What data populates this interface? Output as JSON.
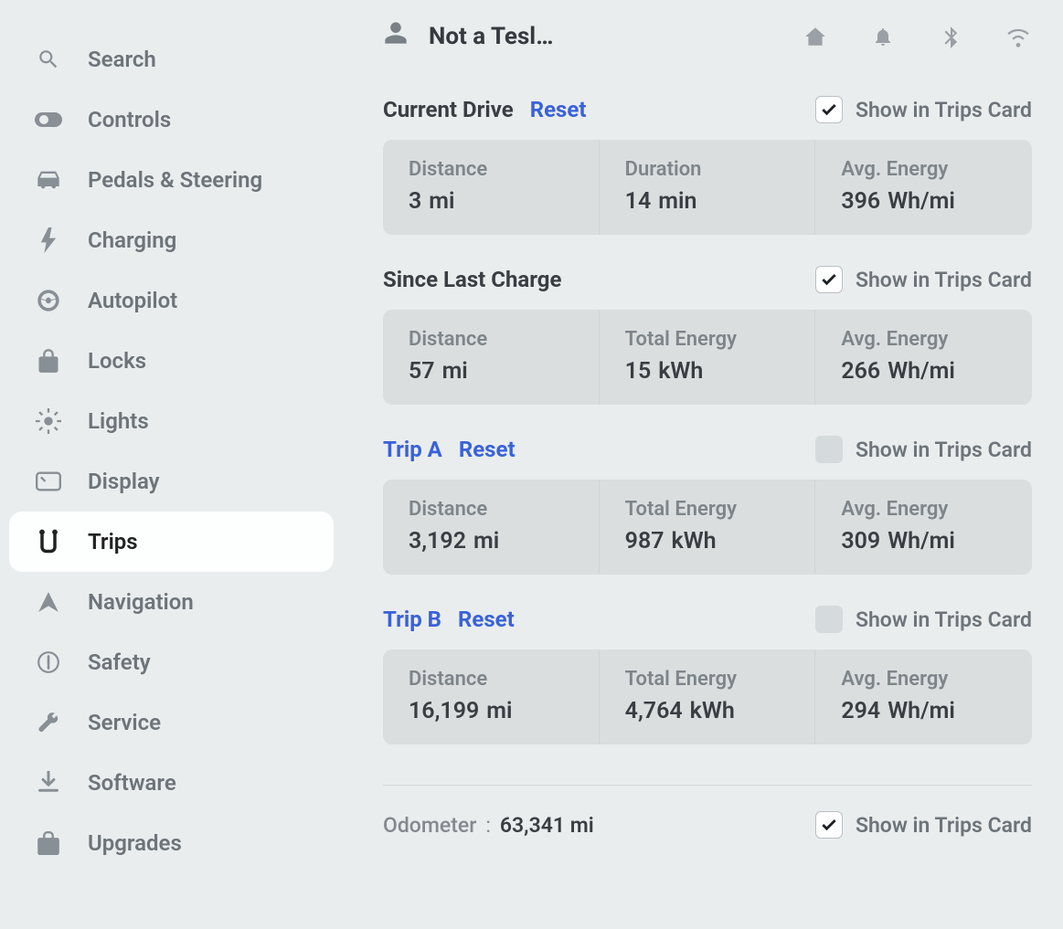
{
  "sidebar": {
    "items": [
      {
        "label": "Search",
        "icon": "search-icon"
      },
      {
        "label": "Controls",
        "icon": "toggle-icon"
      },
      {
        "label": "Pedals & Steering",
        "icon": "car-icon"
      },
      {
        "label": "Charging",
        "icon": "bolt-icon"
      },
      {
        "label": "Autopilot",
        "icon": "steering-icon"
      },
      {
        "label": "Locks",
        "icon": "lock-icon"
      },
      {
        "label": "Lights",
        "icon": "lights-icon"
      },
      {
        "label": "Display",
        "icon": "display-icon"
      },
      {
        "label": "Trips",
        "icon": "trips-icon"
      },
      {
        "label": "Navigation",
        "icon": "nav-icon"
      },
      {
        "label": "Safety",
        "icon": "safety-icon"
      },
      {
        "label": "Service",
        "icon": "wrench-icon"
      },
      {
        "label": "Software",
        "icon": "download-icon"
      },
      {
        "label": "Upgrades",
        "icon": "bag-icon"
      }
    ],
    "active_index": 8
  },
  "header": {
    "user_name": "Not a Tesl…"
  },
  "labels": {
    "reset": "Reset",
    "show_in_trips": "Show in Trips Card",
    "distance": "Distance",
    "duration": "Duration",
    "total_energy": "Total Energy",
    "avg_energy": "Avg. Energy",
    "odometer": "Odometer"
  },
  "sections": {
    "current_drive": {
      "title": "Current Drive",
      "title_is_link": false,
      "resettable": true,
      "show_checked": true,
      "metrics": [
        {
          "label_key": "distance",
          "value": "3",
          "unit": "mi"
        },
        {
          "label_key": "duration",
          "value": "14",
          "unit": "min"
        },
        {
          "label_key": "avg_energy",
          "value": "396",
          "unit": "Wh/mi"
        }
      ]
    },
    "since_charge": {
      "title": "Since Last Charge",
      "title_is_link": false,
      "resettable": false,
      "show_checked": true,
      "metrics": [
        {
          "label_key": "distance",
          "value": "57",
          "unit": "mi"
        },
        {
          "label_key": "total_energy",
          "value": "15",
          "unit": "kWh"
        },
        {
          "label_key": "avg_energy",
          "value": "266",
          "unit": "Wh/mi"
        }
      ]
    },
    "trip_a": {
      "title": "Trip A",
      "title_is_link": true,
      "resettable": true,
      "show_checked": false,
      "metrics": [
        {
          "label_key": "distance",
          "value": "3,192",
          "unit": "mi"
        },
        {
          "label_key": "total_energy",
          "value": "987",
          "unit": "kWh"
        },
        {
          "label_key": "avg_energy",
          "value": "309",
          "unit": "Wh/mi"
        }
      ]
    },
    "trip_b": {
      "title": "Trip B",
      "title_is_link": true,
      "resettable": true,
      "show_checked": false,
      "metrics": [
        {
          "label_key": "distance",
          "value": "16,199",
          "unit": "mi"
        },
        {
          "label_key": "total_energy",
          "value": "4,764",
          "unit": "kWh"
        },
        {
          "label_key": "avg_energy",
          "value": "294",
          "unit": "Wh/mi"
        }
      ]
    }
  },
  "odometer": {
    "value": "63,341",
    "unit": "mi",
    "show_checked": true
  }
}
